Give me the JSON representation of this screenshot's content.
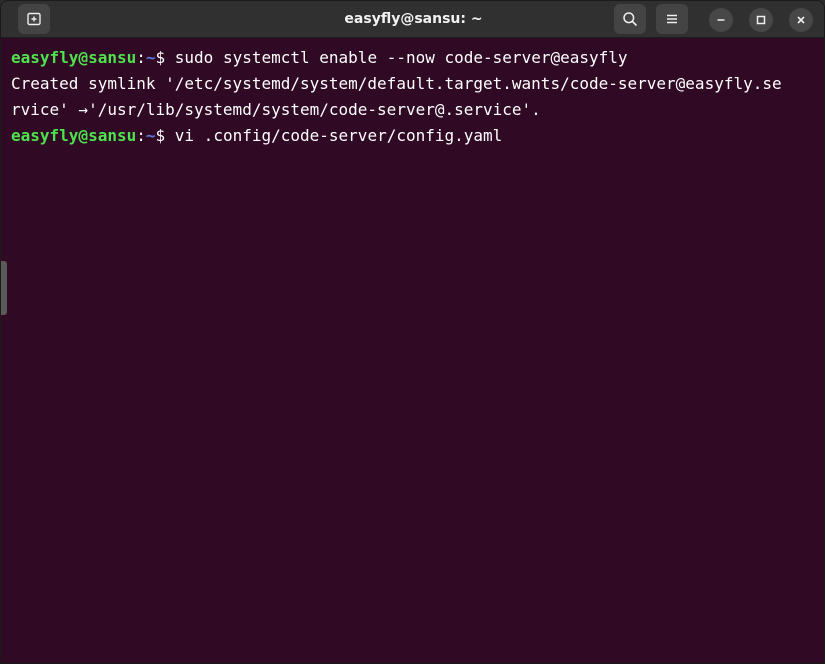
{
  "window": {
    "title": "easyfly@sansu: ~",
    "colors": {
      "background": "#300a24",
      "user_host": "#4ee34e",
      "path": "#5a79d8",
      "text": "#ffffff",
      "titlebar": "#303030"
    }
  },
  "titlebar": {
    "icons": {
      "new_tab": "new-tab-icon",
      "search": "search-icon",
      "menu": "hamburger-menu-icon",
      "minimize": "minimize-icon",
      "maximize": "maximize-icon",
      "close": "close-icon"
    }
  },
  "terminal": {
    "lines": [
      {
        "user_host": "easyfly@sansu",
        "sep": ":",
        "path": "~",
        "prompt": "$ ",
        "command": "sudo systemctl enable --now code-server@easyfly"
      },
      {
        "output": "Created symlink '/etc/systemd/system/default.target.wants/code-server@easyfly.se"
      },
      {
        "output": "rvice' →'/usr/lib/systemd/system/code-server@.service'."
      },
      {
        "user_host": "easyfly@sansu",
        "sep": ":",
        "path": "~",
        "prompt": "$ ",
        "command": "vi .config/code-server/config.yaml"
      }
    ]
  }
}
